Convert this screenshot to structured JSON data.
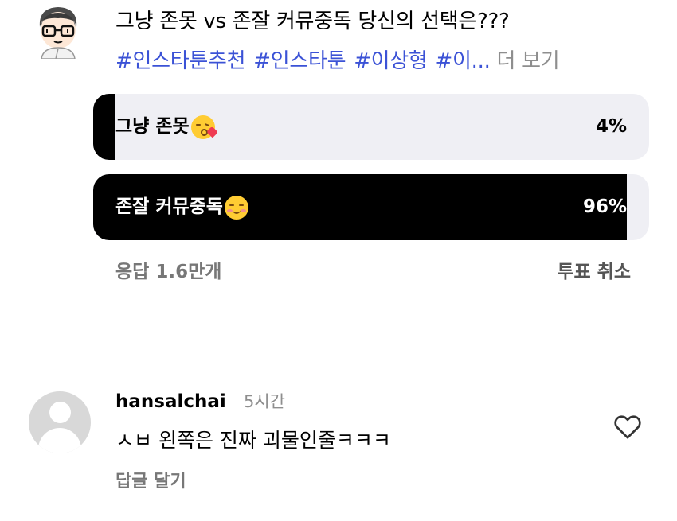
{
  "post": {
    "title": "그냥 존못 vs 존잘 커뮤중독 당신의 선택은???",
    "tags": [
      "#인스타툰추천",
      "#인스타툰",
      "#이상형",
      "#이..."
    ],
    "more_label": "더 보기"
  },
  "poll": {
    "options": [
      {
        "label": "그냥 존못",
        "emoji": "kissing-heart-emoji",
        "percent_label": "4%",
        "percent": 4
      },
      {
        "label": "존잘 커뮤중독",
        "emoji": "smirk-emoji",
        "percent_label": "96%",
        "percent": 96
      }
    ],
    "responses_label": "응답 1.6만개",
    "cancel_label": "투표 취소"
  },
  "comment": {
    "username": "hansalchai",
    "time": "5시간",
    "text": "ㅅㅂ 왼쪽은 진짜 괴물인줄ㅋㅋㅋ",
    "reply_label": "답글 달기",
    "like_icon": "heart-icon"
  },
  "colors": {
    "hashtag": "#3b52d6",
    "poll_fill": "#000000",
    "poll_track": "#efeff4",
    "muted_text": "#8e8e8e"
  }
}
